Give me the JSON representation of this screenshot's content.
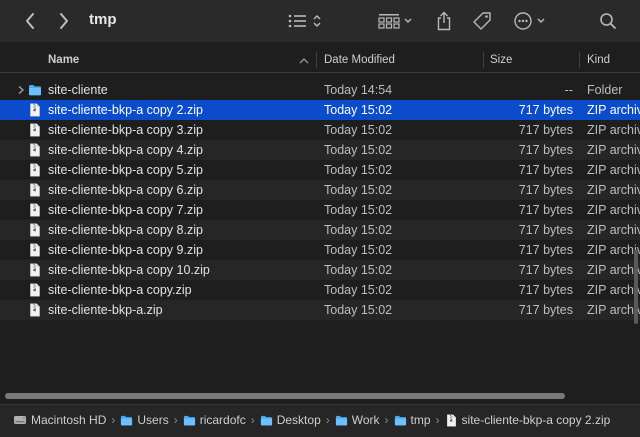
{
  "window": {
    "title": "tmp"
  },
  "toolbar": {
    "back_icon": "chevron-left-icon",
    "forward_icon": "chevron-right-icon",
    "view_icon": "list-view-icon",
    "group_icon": "group-grid-icon",
    "share_icon": "share-icon",
    "tag_icon": "tag-icon",
    "action_icon": "ellipsis-circle-icon",
    "search_icon": "search-icon"
  },
  "columns": {
    "name": "Name",
    "date": "Date Modified",
    "size": "Size",
    "kind": "Kind"
  },
  "files": [
    {
      "name": "site-cliente",
      "date": "Today 14:54",
      "size": "--",
      "kind": "Folder",
      "type": "folder"
    },
    {
      "name": "site-cliente-bkp-a copy 2.zip",
      "date": "Today 15:02",
      "size": "717 bytes",
      "kind": "ZIP archive",
      "type": "zip",
      "selected": true
    },
    {
      "name": "site-cliente-bkp-a copy 3.zip",
      "date": "Today 15:02",
      "size": "717 bytes",
      "kind": "ZIP archive",
      "type": "zip"
    },
    {
      "name": "site-cliente-bkp-a copy 4.zip",
      "date": "Today 15:02",
      "size": "717 bytes",
      "kind": "ZIP archive",
      "type": "zip"
    },
    {
      "name": "site-cliente-bkp-a copy 5.zip",
      "date": "Today 15:02",
      "size": "717 bytes",
      "kind": "ZIP archive",
      "type": "zip"
    },
    {
      "name": "site-cliente-bkp-a copy 6.zip",
      "date": "Today 15:02",
      "size": "717 bytes",
      "kind": "ZIP archive",
      "type": "zip"
    },
    {
      "name": "site-cliente-bkp-a copy 7.zip",
      "date": "Today 15:02",
      "size": "717 bytes",
      "kind": "ZIP archive",
      "type": "zip"
    },
    {
      "name": "site-cliente-bkp-a copy 8.zip",
      "date": "Today 15:02",
      "size": "717 bytes",
      "kind": "ZIP archive",
      "type": "zip"
    },
    {
      "name": "site-cliente-bkp-a copy 9.zip",
      "date": "Today 15:02",
      "size": "717 bytes",
      "kind": "ZIP archive",
      "type": "zip"
    },
    {
      "name": "site-cliente-bkp-a copy 10.zip",
      "date": "Today 15:02",
      "size": "717 bytes",
      "kind": "ZIP archive",
      "type": "zip"
    },
    {
      "name": "site-cliente-bkp-a copy.zip",
      "date": "Today 15:02",
      "size": "717 bytes",
      "kind": "ZIP archive",
      "type": "zip"
    },
    {
      "name": "site-cliente-bkp-a.zip",
      "date": "Today 15:02",
      "size": "717 bytes",
      "kind": "ZIP archive",
      "type": "zip"
    }
  ],
  "path": [
    {
      "label": "Macintosh HD",
      "icon": "disk-icon"
    },
    {
      "label": "Users",
      "icon": "folder-icon"
    },
    {
      "label": "ricardofc",
      "icon": "folder-icon"
    },
    {
      "label": "Desktop",
      "icon": "folder-icon"
    },
    {
      "label": "Work",
      "icon": "folder-icon"
    },
    {
      "label": "tmp",
      "icon": "folder-icon"
    },
    {
      "label": "site-cliente-bkp-a copy 2.zip",
      "icon": "zip-file-icon"
    }
  ],
  "colors": {
    "selection": "#0a4ccc",
    "folder": "#4aa8f0",
    "background": "#1e1e1e"
  }
}
